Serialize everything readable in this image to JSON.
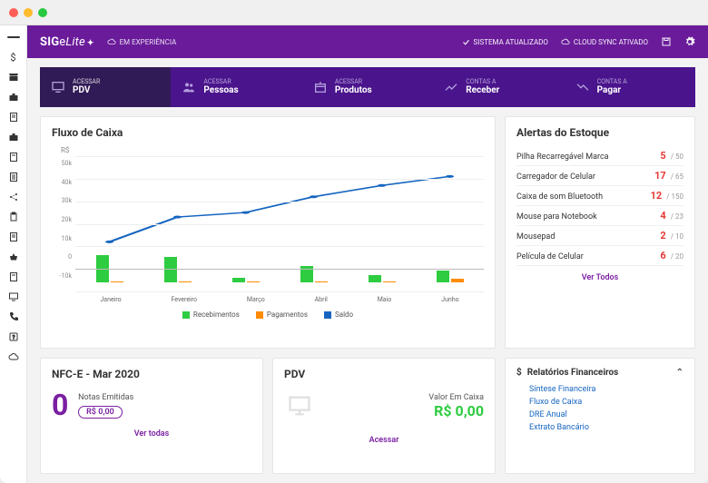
{
  "brand_pre": "SIG",
  "brand_e": "e",
  "brand_post": "Lite",
  "experience_label": "EM EXPERIÊNCIA",
  "status_updated": "SISTEMA ATUALIZADO",
  "status_cloud": "CLOUD SYNC ATIVADO",
  "quick": {
    "access_label": "ACESSAR",
    "contas_label": "CONTAS A",
    "pdv": "PDV",
    "pessoas": "Pessoas",
    "produtos": "Produtos",
    "receber": "Receber",
    "pagar": "Pagar"
  },
  "chart_title": "Fluxo de Caixa",
  "chart_ylabel": "R$",
  "chart_data": {
    "type": "bar+line",
    "categories": [
      "Janeiro",
      "Fevereiro",
      "Março",
      "Abril",
      "Maio",
      "Junho"
    ],
    "series": [
      {
        "name": "Recebimentos",
        "type": "bar",
        "color": "#2ecc40",
        "values": [
          12000,
          11000,
          2000,
          7000,
          3000,
          5000
        ]
      },
      {
        "name": "Pagamentos",
        "type": "bar",
        "color": "#ff8c00",
        "values": [
          0,
          0,
          0,
          0,
          0,
          1500
        ]
      },
      {
        "name": "Saldo",
        "type": "line",
        "color": "#1565c0",
        "values": [
          12000,
          23000,
          25000,
          32000,
          37000,
          41000
        ]
      }
    ],
    "ylabel": "R$",
    "ylim": [
      -10000,
      50000
    ],
    "yticks": [
      "-10k",
      "0",
      "10k",
      "20k",
      "30k",
      "40k",
      "50k"
    ]
  },
  "legend_recebimentos": "Recebimentos",
  "legend_pagamentos": "Pagamentos",
  "legend_saldo": "Saldo",
  "alerts_title": "Alertas do Estoque",
  "alerts": [
    {
      "name": "Pilha Recarregável Marca",
      "count": "5",
      "total": "/ 50"
    },
    {
      "name": "Carregador de Celular",
      "count": "17",
      "total": "/ 65"
    },
    {
      "name": "Caixa de som Bluetooth",
      "count": "12",
      "total": "/ 150"
    },
    {
      "name": "Mouse para Notebook",
      "count": "4",
      "total": "/ 23"
    },
    {
      "name": "Mousepad",
      "count": "2",
      "total": "/ 10"
    },
    {
      "name": "Película de Celular",
      "count": "6",
      "total": "/ 20"
    }
  ],
  "alerts_see_all": "Ver Todos",
  "nfce_title": "NFC-E - Mar 2020",
  "nfce_count": "0",
  "nfce_sub": "Notas Emitidas",
  "nfce_badge": "R$ 0,00",
  "nfce_see_all": "Ver todas",
  "pdv_title": "PDV",
  "pdv_label": "Valor Em Caixa",
  "pdv_value": "R$ 0,00",
  "pdv_access": "Acessar",
  "reports_title": "Relatórios Financeiros",
  "reports": [
    "Síntese Financeira",
    "Fluxo de Caixa",
    "DRE Anual",
    "Extrato Bancário"
  ]
}
